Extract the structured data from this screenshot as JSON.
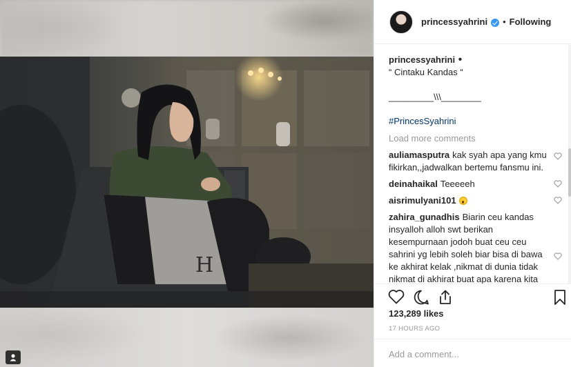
{
  "post": {
    "username": "princessyahrini",
    "follow_separator": "•",
    "follow_state": "Following"
  },
  "caption": {
    "username": "princessyahrini",
    "separator": "•",
    "line1": "“ Cintaku Kandas “",
    "line2": "_________\\\\\\________",
    "hashtag": "#PrincesSyahrini"
  },
  "load_more": "Load more comments",
  "comments": [
    {
      "user": "auliamasputra",
      "text": "kak syah apa yang kmu fikirkan,,jadwalkan bertemu fansmu ini."
    },
    {
      "user": "deinahaikal",
      "text": "Teeeeeh"
    },
    {
      "user": "aisrimulyani101",
      "text": ""
    },
    {
      "user": "zahira_gunadhis",
      "text": "Biarin ceu kandas insyalloh alloh swt berikan kesempurnaan jodoh buat ceu ceu sahrini yg lebih soleh biar bisa di bawa ke akhirat kelak ,nikmat di dunia tidak nikmat di akhirat buat apa karena kita akan lebih lama hidup di akhirat"
    }
  ],
  "likes": "123,289 likes",
  "timestamp": "17 HOURS AGO",
  "add_comment_placeholder": "Add a comment...",
  "colors": {
    "verified": "#3897f0",
    "link": "#003569",
    "muted": "#999999"
  }
}
